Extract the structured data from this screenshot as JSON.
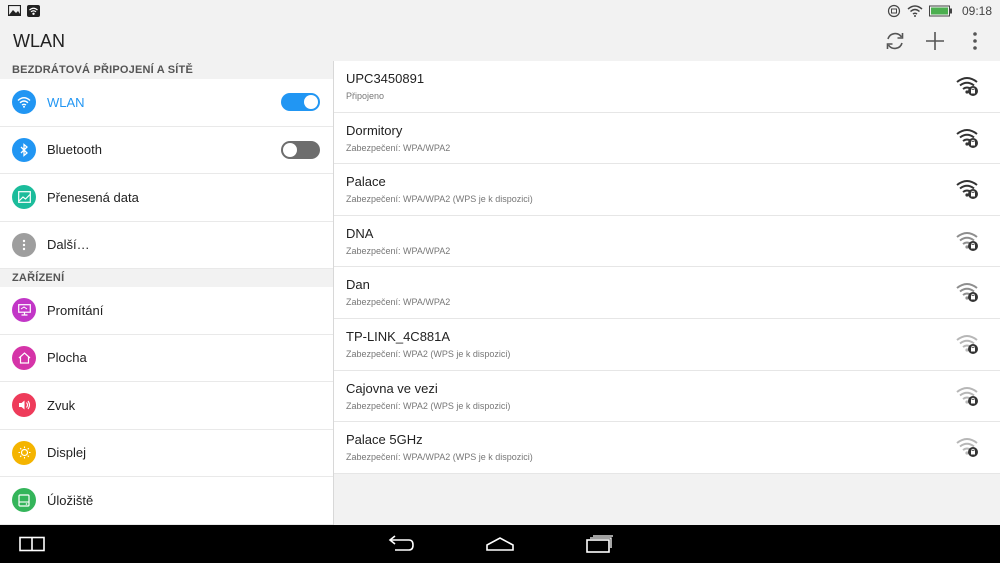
{
  "status": {
    "time": "09:18"
  },
  "appbar": {
    "title": "WLAN"
  },
  "sections": [
    {
      "title": "BEZDRÁTOVÁ PŘIPOJENÍ A SÍTĚ",
      "items": [
        {
          "label": "WLAN",
          "icon": "wifi-icon",
          "color": "#2196f3",
          "toggle": "on",
          "active": true
        },
        {
          "label": "Bluetooth",
          "icon": "bluetooth-icon",
          "color": "#2196f3",
          "toggle": "off",
          "active": false
        },
        {
          "label": "Přenesená data",
          "icon": "data-usage-icon",
          "color": "#1bbc9b",
          "active": false
        },
        {
          "label": "Další…",
          "icon": "more-icon",
          "color": "#9e9e9e",
          "active": false
        }
      ]
    },
    {
      "title": "ZAŘÍZENÍ",
      "items": [
        {
          "label": "Promítání",
          "icon": "cast-icon",
          "color": "#c236c7",
          "active": false
        },
        {
          "label": "Plocha",
          "icon": "home-icon",
          "color": "#d534a8",
          "active": false
        },
        {
          "label": "Zvuk",
          "icon": "volume-icon",
          "color": "#ee3b5a",
          "active": false
        },
        {
          "label": "Displej",
          "icon": "brightness-icon",
          "color": "#f4b400",
          "active": false
        },
        {
          "label": "Úložiště",
          "icon": "storage-icon",
          "color": "#34b55a",
          "active": false
        }
      ]
    }
  ],
  "networks": [
    {
      "name": "UPC3450891",
      "sub": "Připojeno",
      "signal": "strong"
    },
    {
      "name": "Dormitory",
      "sub": "Zabezpečení: WPA/WPA2",
      "signal": "strong"
    },
    {
      "name": "Palace",
      "sub": "Zabezpečení: WPA/WPA2 (WPS je k dispozici)",
      "signal": "strong"
    },
    {
      "name": "DNA",
      "sub": "Zabezpečení: WPA/WPA2",
      "signal": "medium"
    },
    {
      "name": "Dan",
      "sub": "Zabezpečení: WPA/WPA2",
      "signal": "medium"
    },
    {
      "name": "TP-LINK_4C881A",
      "sub": "Zabezpečení: WPA2 (WPS je k dispozici)",
      "signal": "weak"
    },
    {
      "name": "Cajovna ve vezi",
      "sub": "Zabezpečení: WPA2 (WPS je k dispozici)",
      "signal": "weak"
    },
    {
      "name": "Palace 5GHz",
      "sub": "Zabezpečení: WPA/WPA2 (WPS je k dispozici)",
      "signal": "weak"
    }
  ],
  "colors": {
    "accent": "#2196f3",
    "toggle_off": "#6d6d6d"
  }
}
